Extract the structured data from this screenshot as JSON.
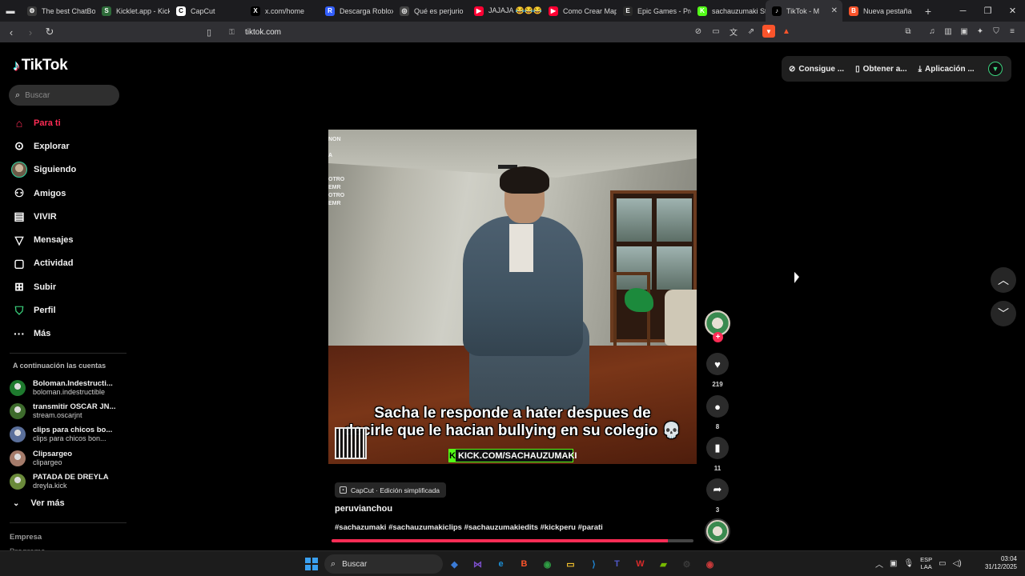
{
  "browser": {
    "tabs": [
      {
        "title": "The best ChatBot",
        "icon": "chatbot-icon",
        "color": "#3a3a3a",
        "glyph": "⚙"
      },
      {
        "title": "Kicklet.app - Kick",
        "icon": "kicklet-icon",
        "color": "#2e6b3a",
        "glyph": "S"
      },
      {
        "title": "CapCut",
        "icon": "capcut-icon",
        "color": "#ffffff",
        "glyph": "C"
      },
      {
        "title": "x.com/home",
        "icon": "x-icon",
        "color": "#000000",
        "glyph": "X"
      },
      {
        "title": "Descarga Roblox",
        "icon": "roblox-icon",
        "color": "#335fff",
        "glyph": "R"
      },
      {
        "title": "Qué es perjurio",
        "icon": "chatgpt-icon",
        "color": "#444444",
        "glyph": "◎"
      },
      {
        "title": "JAJAJA 😂😂😂",
        "icon": "youtube-icon",
        "color": "#ff0033",
        "glyph": "▶"
      },
      {
        "title": "Como Crear Map",
        "icon": "youtube-icon",
        "color": "#ff0033",
        "glyph": "▶"
      },
      {
        "title": "Epic Games - Pro",
        "icon": "epic-icon",
        "color": "#2a2a2a",
        "glyph": "E"
      },
      {
        "title": "sachauzumaki Sti",
        "icon": "kick-icon",
        "color": "#53fc18",
        "glyph": "K"
      },
      {
        "title": "TikTok - M",
        "icon": "tiktok-icon",
        "color": "#000000",
        "glyph": "♪",
        "active": true
      },
      {
        "title": "Nueva pestaña",
        "icon": "brave-icon",
        "color": "#fb542b",
        "glyph": "B"
      }
    ],
    "url": "tiktok.com"
  },
  "sidebar": {
    "logo": "TikTok",
    "search_placeholder": "Buscar",
    "nav": [
      {
        "label": "Para ti",
        "icon": "home-icon",
        "active": true
      },
      {
        "label": "Explorar",
        "icon": "compass-icon"
      },
      {
        "label": "Siguiendo",
        "icon": "following-avatar-icon"
      },
      {
        "label": "Amigos",
        "icon": "friends-icon"
      },
      {
        "label": "VIVIR",
        "icon": "live-icon"
      },
      {
        "label": "Mensajes",
        "icon": "messages-icon"
      },
      {
        "label": "Actividad",
        "icon": "activity-icon"
      },
      {
        "label": "Subir",
        "icon": "upload-icon"
      },
      {
        "label": "Perfil",
        "icon": "profile-icon"
      },
      {
        "label": "Más",
        "icon": "more-icon"
      }
    ],
    "accounts_title": "A continuación las cuentas",
    "accounts": [
      {
        "name": "Boloman.Indestructi...",
        "handle": "boloman.indestructible",
        "color": "#1e7a2e"
      },
      {
        "name": "transmitir OSCAR JN...",
        "handle": "stream.oscarjnt",
        "color": "#3d6b2c"
      },
      {
        "name": "clips para chicos bo...",
        "handle": "clips para chicos bon...",
        "color": "#5a6f9a"
      },
      {
        "name": "Clipsargeo",
        "handle": "clipargeo",
        "color": "#a47b6a"
      },
      {
        "name": "PATADA DE DREYLA",
        "handle": "dreyla.kick",
        "color": "#6a8a3a"
      }
    ],
    "see_more": "Ver más",
    "footer_title": "Empresa",
    "footer_next": "Programa"
  },
  "top_actions": [
    {
      "label": "Consigue ...",
      "icon": "coin-icon"
    },
    {
      "label": "Obtener a...",
      "icon": "phone-icon"
    },
    {
      "label": "Aplicación ...",
      "icon": "download-icon"
    }
  ],
  "video": {
    "overlay_lines": [
      "NON",
      "",
      "A",
      "",
      "",
      "OTRO",
      "EMR",
      "OTRO",
      "EMR"
    ],
    "caption_line1": "Sacha le responde a hater  despues de",
    "caption_line2": "decirle que le hacian bullying en su colegio 💀",
    "kick_text": "KICK.COM/SACHAUZUMAKI",
    "badge": "CapCut · Edición simplificada",
    "author": "peruvianchou",
    "hashtags": "#sachazumaki #sachauzumakiclips #sachauzumakiedits #kickperu #parati",
    "progress": 0.93
  },
  "actions": {
    "likes": "219",
    "comments": "8",
    "saves": "11",
    "shares": "3"
  },
  "taskbar": {
    "search": "Buscar",
    "lang1": "ESP",
    "lang2": "LAA",
    "time": "03:04",
    "date": "31/12/2025",
    "apps": [
      {
        "name": "copilot-icon",
        "color": "#3a7bd5",
        "glyph": "◆"
      },
      {
        "name": "visual-studio-icon",
        "color": "#7b4fc9",
        "glyph": "⋈"
      },
      {
        "name": "edge-icon",
        "color": "#1b8fd6",
        "glyph": "e"
      },
      {
        "name": "brave-icon",
        "color": "#fb542b",
        "glyph": "B"
      },
      {
        "name": "chrome-icon",
        "color": "#2f9e44",
        "glyph": "◉"
      },
      {
        "name": "explorer-icon",
        "color": "#f2c12e",
        "glyph": "▭"
      },
      {
        "name": "vscode-icon",
        "color": "#1f88d8",
        "glyph": "⟩"
      },
      {
        "name": "teams-icon",
        "color": "#5059c9",
        "glyph": "T"
      },
      {
        "name": "wps-icon",
        "color": "#d92b2b",
        "glyph": "W"
      },
      {
        "name": "nvidia-icon",
        "color": "#76b900",
        "glyph": "▰"
      },
      {
        "name": "steam-icon",
        "color": "#3a3a3a",
        "glyph": "⚙"
      },
      {
        "name": "chrome-alt-icon",
        "color": "#c93a3a",
        "glyph": "◉"
      }
    ]
  }
}
